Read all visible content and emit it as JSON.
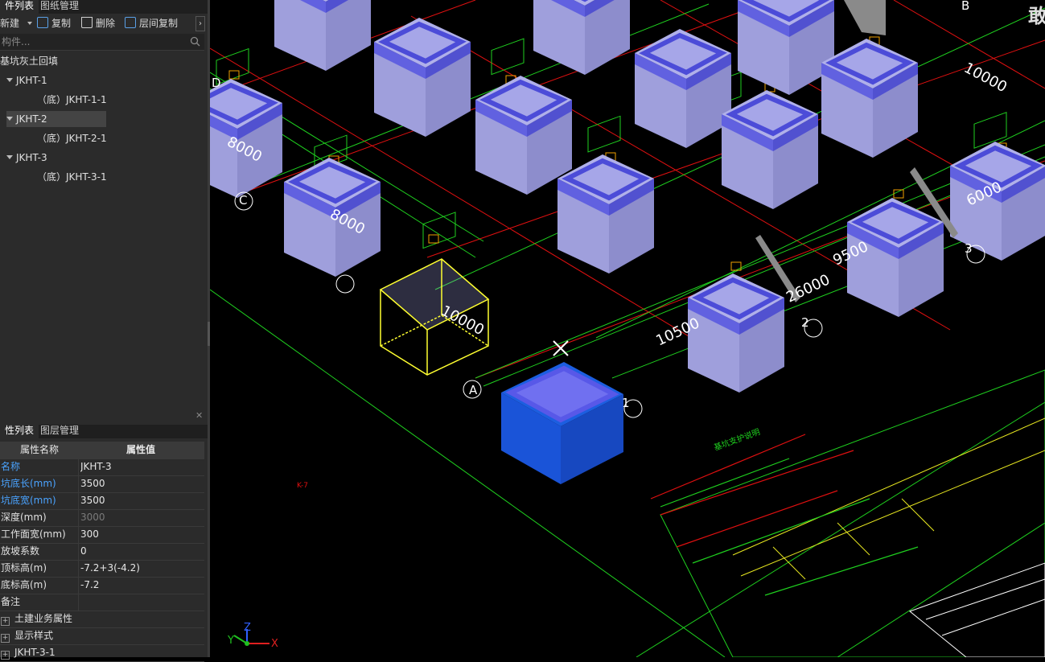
{
  "top_tabs": {
    "components": "件列表",
    "drawings": "图纸管理"
  },
  "toolbar": {
    "new": "新建",
    "copy": "复制",
    "delete": "删除",
    "floor_copy": "层间复制"
  },
  "search": {
    "placeholder": "构件..."
  },
  "tree": {
    "root": "基坑灰土回填",
    "items": [
      {
        "label": "JKHT-1",
        "child": "（底）JKHT-1-1"
      },
      {
        "label": "JKHT-2",
        "child": "（底）JKHT-2-1"
      },
      {
        "label": "JKHT-3",
        "child": "（底）JKHT-3-1"
      }
    ]
  },
  "bottom_tabs": {
    "properties": "性列表",
    "layers": "图层管理"
  },
  "props": {
    "header": {
      "name": "属性名称",
      "value": "属性值"
    },
    "rows": [
      {
        "name": "名称",
        "value": "JKHT-3"
      },
      {
        "name": "坑底长(mm)",
        "value": "3500"
      },
      {
        "name": "坑底宽(mm)",
        "value": "3500"
      },
      {
        "name": "深度(mm)",
        "value": "3000"
      },
      {
        "name": "工作面宽(mm)",
        "value": "300"
      },
      {
        "name": "放坡系数",
        "value": "0"
      },
      {
        "name": "顶标高(m)",
        "value": "-7.2+3(-4.2)"
      },
      {
        "name": "底标高(m)",
        "value": "-7.2"
      },
      {
        "name": "备注",
        "value": ""
      }
    ],
    "groups": [
      "土建业务属性",
      "显示样式",
      "JKHT-3-1"
    ]
  },
  "viewport": {
    "corner_text": "敢",
    "dim_labels": [
      "8000",
      "8000",
      "10000",
      "10000",
      "6000",
      "9500",
      "26000",
      "10500"
    ],
    "axis_labels": [
      "D",
      "C",
      "B",
      "A",
      "1",
      "2",
      "3",
      "B"
    ],
    "gizmo": {
      "x": "X",
      "y": "Y",
      "z": "Z"
    },
    "small_label": "K-7",
    "notes_title": "基坑支护说明"
  }
}
